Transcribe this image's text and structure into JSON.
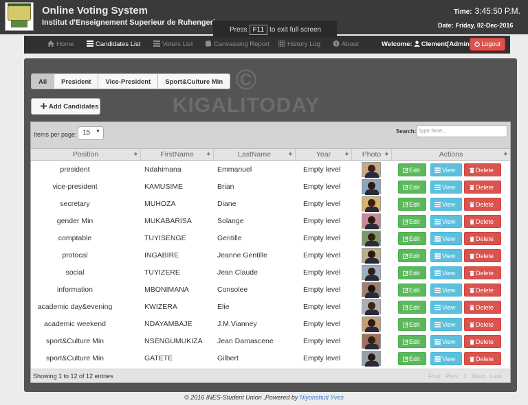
{
  "header": {
    "title": "Online Voting System",
    "subtitle": "Institut d'Enseignement Superieur de Ruhengeri",
    "time_label": "Time:",
    "time_value": "3:45:50 P.M.",
    "date_label": "Date:",
    "date_value": "Friday, 02-Dec-2016"
  },
  "f11": {
    "prefix": "Press",
    "key": "F11",
    "suffix": "to exit full screen"
  },
  "nav": {
    "items": [
      {
        "label": "Home",
        "icon": "home-icon"
      },
      {
        "label": "Candidates List",
        "icon": "list-icon"
      },
      {
        "label": "Voters List",
        "icon": "list-icon"
      },
      {
        "label": "Canvassing Report",
        "icon": "book-icon"
      },
      {
        "label": "History Log",
        "icon": "grid-icon"
      },
      {
        "label": "About",
        "icon": "info-icon"
      }
    ],
    "welcome": "Welcome:",
    "user": "Clement[Admin]",
    "logout": "Logout"
  },
  "watermark": {
    "symbol": "©",
    "text": "KIGALITODAY"
  },
  "filter_tabs": [
    "All",
    "President",
    "Vice-President",
    "Sport&Culture Min"
  ],
  "add_button": "Add Candidates",
  "table": {
    "items_per_page_label": "Items per page:",
    "items_per_page": "15",
    "search_label": "Search:",
    "search_placeholder": "type here...",
    "columns": [
      "Position",
      "FirstName",
      "LastName",
      "Year",
      "Photo",
      "Actions"
    ],
    "rows": [
      {
        "position": "president",
        "first": "Ndahimana",
        "last": "Emmanuel",
        "year": "Empty level"
      },
      {
        "position": "vice-president",
        "first": "KAMUSIME",
        "last": "Brian",
        "year": "Empty level"
      },
      {
        "position": "secretary",
        "first": "MUHOZA",
        "last": "Diane",
        "year": "Empty level"
      },
      {
        "position": "gender Min",
        "first": "MUKABARISA",
        "last": "Solange",
        "year": "Empty level"
      },
      {
        "position": "comptable",
        "first": "TUYISENGE",
        "last": "Gentille",
        "year": "Empty level"
      },
      {
        "position": "protocal",
        "first": "INGABIRE",
        "last": "Jeanne Gentille",
        "year": "Empty level"
      },
      {
        "position": "social",
        "first": "TUYIZERE",
        "last": "Jean Claude",
        "year": "Empty level"
      },
      {
        "position": "information",
        "first": "MBONIMANA",
        "last": "Consolee",
        "year": "Empty level"
      },
      {
        "position": "academic day&evening",
        "first": "KWIZERA",
        "last": "Elie",
        "year": "Empty level"
      },
      {
        "position": "academic weekend",
        "first": "NDAYAMBAJE",
        "last": "J.M.Vianney",
        "year": "Empty level"
      },
      {
        "position": "sport&Culture Min",
        "first": "NSENGUMUKIZA",
        "last": "Jean Damascene",
        "year": "Empty level"
      },
      {
        "position": "sport&Culture Min",
        "first": "GATETE",
        "last": "Gilbert",
        "year": "Empty level"
      }
    ],
    "actions": {
      "edit": "Edit",
      "view": "View",
      "delete": "Delete"
    },
    "showing": "Showing 1 to 12 of 12 entries",
    "pager": [
      "First",
      "Prev",
      "1",
      "Next",
      "Last"
    ]
  },
  "footer": {
    "text": "© 2016 INES-Student Union ,Powered by ",
    "author": "Niyonshuti Yves"
  },
  "colors": {
    "edit": "#5cb85c",
    "view": "#5bc0de",
    "delete": "#d9534f",
    "header": "#3a3a3a",
    "panel": "#545454"
  }
}
